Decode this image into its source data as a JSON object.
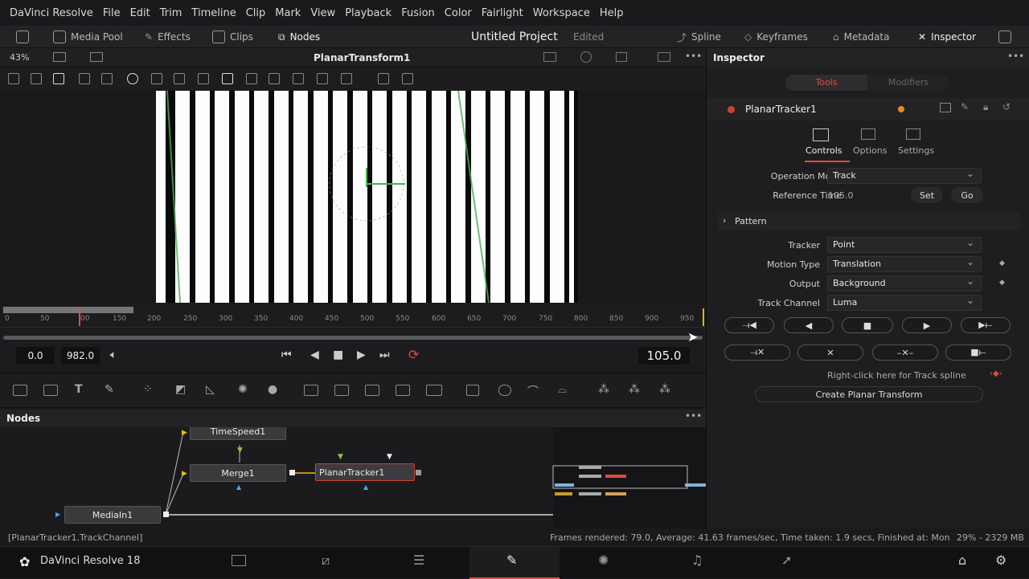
{
  "menu": [
    "DaVinci Resolve",
    "File",
    "Edit",
    "Trim",
    "Timeline",
    "Clip",
    "Mark",
    "View",
    "Playback",
    "Fusion",
    "Color",
    "Fairlight",
    "Workspace",
    "Help"
  ],
  "toolbar": {
    "media_pool": "Media Pool",
    "effects": "Effects",
    "clips": "Clips",
    "nodes": "Nodes",
    "project_title": "Untitled Project",
    "project_status": "Edited",
    "spline": "Spline",
    "keyframes": "Keyframes",
    "metadata": "Metadata",
    "inspector": "Inspector"
  },
  "viewer": {
    "zoom": "43%",
    "title": "PlanarTransform1"
  },
  "ruler_ticks": [
    "0",
    "50",
    "00",
    "150",
    "200",
    "250",
    "300",
    "350",
    "400",
    "450",
    "500",
    "550",
    "600",
    "650",
    "700",
    "750",
    "800",
    "850",
    "900",
    "950"
  ],
  "transport": {
    "start": "0.0",
    "end": "982.0",
    "current": "105.0"
  },
  "nodes": {
    "header": "Nodes",
    "items": {
      "timespeed": "TimeSpeed1",
      "merge": "Merge1",
      "planar": "PlanarTracker1",
      "media_in": "MediaIn1"
    }
  },
  "status": {
    "left": "[PlanarTracker1.TrackChannel]",
    "right": "Frames rendered: 79.0,  Average: 41.63 frames/sec,  Time taken: 1.9 secs,  Finished at: Mon",
    "memory": "29% - 2329 MB"
  },
  "pagebar": {
    "app": "DaVinci Resolve 18"
  },
  "inspector": {
    "title": "Inspector",
    "tabs": {
      "tools": "Tools",
      "modifiers": "Modifiers"
    },
    "node_name": "PlanarTracker1",
    "subtabs": {
      "controls": "Controls",
      "options": "Options",
      "settings": "Settings"
    },
    "operation_mode": {
      "label": "Operation Mode",
      "value": "Track"
    },
    "reference_time": {
      "label": "Reference Time",
      "value": "105.0",
      "set": "Set",
      "go": "Go"
    },
    "pattern": "Pattern",
    "tracker": {
      "label": "Tracker",
      "value": "Point"
    },
    "motion_type": {
      "label": "Motion Type",
      "value": "Translation"
    },
    "output": {
      "label": "Output",
      "value": "Background"
    },
    "track_channel": {
      "label": "Track Channel",
      "value": "Luma"
    },
    "spline_hint": "Right-click here for Track spline",
    "create_button": "Create Planar Transform"
  },
  "colors": {
    "accent": "#e64b3c",
    "active_page": "#e64b3c",
    "node_selected": "#c9452e"
  }
}
